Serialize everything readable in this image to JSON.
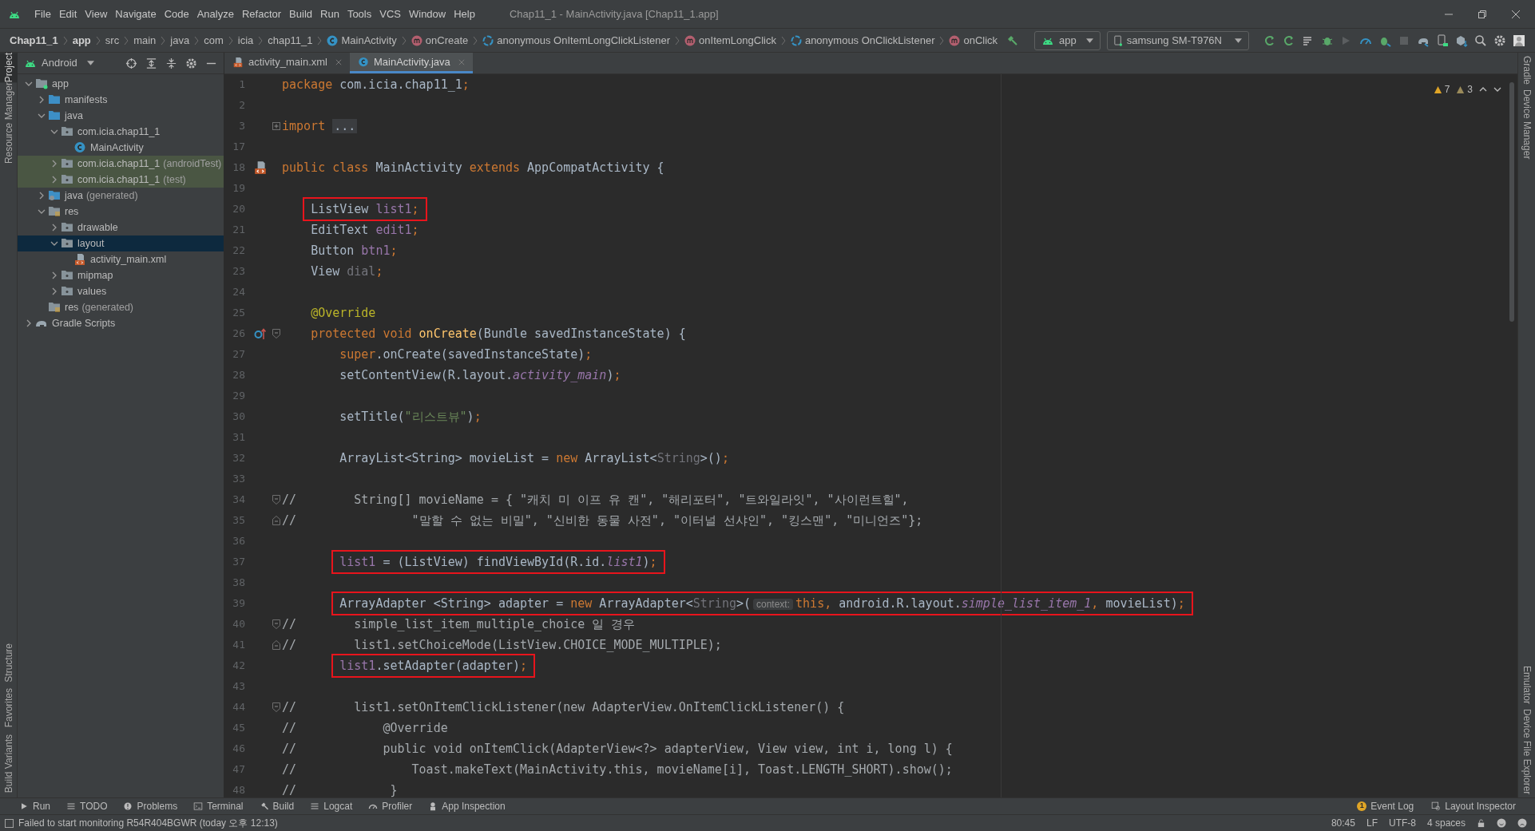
{
  "window": {
    "title": "Chap11_1 - MainActivity.java [Chap11_1.app]"
  },
  "menu": [
    "File",
    "Edit",
    "View",
    "Navigate",
    "Code",
    "Analyze",
    "Refactor",
    "Build",
    "Run",
    "Tools",
    "VCS",
    "Window",
    "Help"
  ],
  "breadcrumbs": [
    {
      "text": "Chap11_1",
      "kind": "project"
    },
    {
      "text": "app",
      "kind": "project"
    },
    {
      "text": "src",
      "kind": "folder"
    },
    {
      "text": "main",
      "kind": "folder"
    },
    {
      "text": "java",
      "kind": "folder"
    },
    {
      "text": "com",
      "kind": "folder"
    },
    {
      "text": "icia",
      "kind": "folder"
    },
    {
      "text": "chap11_1",
      "kind": "folder"
    },
    {
      "text": "MainActivity",
      "kind": "class"
    },
    {
      "text": "onCreate",
      "kind": "method"
    },
    {
      "text": "anonymous OnItemLongClickListener",
      "kind": "anonymous"
    },
    {
      "text": "onItemLongClick",
      "kind": "method"
    },
    {
      "text": "anonymous OnClickListener",
      "kind": "anonymous"
    },
    {
      "text": "onClick",
      "kind": "method"
    }
  ],
  "toolbar": {
    "run_config": "app",
    "device": "samsung SM-T976N"
  },
  "left_tool_tabs": [
    {
      "label": "Project",
      "selected": true
    },
    {
      "label": "Resource Manager",
      "selected": false
    }
  ],
  "left_tool_tabs_bottom": [
    "Structure",
    "Favorites",
    "Build Variants"
  ],
  "right_tool_tabs": [
    "Gradle",
    "Device Manager",
    "Emulator",
    "Device File Explorer"
  ],
  "project_panel": {
    "view": "Android",
    "tree": [
      {
        "label": "app",
        "kind": "module",
        "expanded": true,
        "selected": false,
        "tinted": false,
        "children": [
          {
            "label": "manifests",
            "kind": "source",
            "expanded": false,
            "selected": false,
            "tinted": false
          },
          {
            "label": "java",
            "kind": "source",
            "expanded": true,
            "selected": false,
            "tinted": false,
            "children": [
              {
                "label": "com.icia.chap11_1",
                "kind": "package",
                "expanded": true,
                "selected": false,
                "tinted": false,
                "children": [
                  {
                    "label": "MainActivity",
                    "kind": "class",
                    "selected": false,
                    "tinted": false
                  }
                ]
              },
              {
                "label": "com.icia.chap11_1",
                "suffix": "(androidTest)",
                "kind": "package",
                "expanded": false,
                "selected": false,
                "tinted": true
              },
              {
                "label": "com.icia.chap11_1",
                "suffix": "(test)",
                "kind": "package",
                "expanded": false,
                "selected": false,
                "tinted": true
              }
            ]
          },
          {
            "label": "java",
            "suffix": "(generated)",
            "kind": "generated",
            "expanded": false,
            "selected": false,
            "tinted": false
          },
          {
            "label": "res",
            "kind": "res",
            "expanded": true,
            "selected": false,
            "tinted": false,
            "children": [
              {
                "label": "drawable",
                "kind": "package",
                "expanded": false,
                "selected": false,
                "tinted": false
              },
              {
                "label": "layout",
                "kind": "package",
                "expanded": true,
                "selected": true,
                "tinted": false,
                "children": [
                  {
                    "label": "activity_main.xml",
                    "kind": "xml",
                    "selected": false,
                    "tinted": false
                  }
                ]
              },
              {
                "label": "mipmap",
                "kind": "package",
                "expanded": false,
                "selected": false,
                "tinted": false
              },
              {
                "label": "values",
                "kind": "package",
                "expanded": false,
                "selected": false,
                "tinted": false
              }
            ]
          },
          {
            "label": "res",
            "suffix": "(generated)",
            "kind": "res",
            "selected": false,
            "tinted": false
          }
        ]
      },
      {
        "label": "Gradle Scripts",
        "kind": "gradle",
        "expanded": false,
        "selected": false,
        "tinted": false
      }
    ]
  },
  "editor_tabs": [
    {
      "label": "activity_main.xml",
      "kind": "xml",
      "selected": false
    },
    {
      "label": "MainActivity.java",
      "kind": "class",
      "selected": true
    }
  ],
  "inspections": [
    {
      "kind": "warning",
      "count": "7"
    },
    {
      "kind": "weak_warning",
      "count": "3"
    }
  ],
  "lines": [
    {
      "number": "1",
      "highlighted": false,
      "tokens": [
        {
          "text": "package",
          "kind": "keyword"
        },
        {
          "text": " com.icia.chap11_1",
          "kind": "plain"
        },
        {
          "text": ";",
          "kind": "punct"
        }
      ]
    },
    {
      "number": "2"
    },
    {
      "number": "3",
      "highlighted": false,
      "fold_mark": {
        "kind": "collapsed"
      },
      "tokens": [
        {
          "text": "import ",
          "kind": "keyword"
        },
        {
          "text": "...",
          "kind": "folded"
        }
      ]
    },
    {
      "number": "17"
    },
    {
      "number": "18",
      "highlighted": false,
      "gutter_icon": {
        "kind": "layout"
      },
      "tokens": [
        {
          "text": "public class ",
          "kind": "keyword"
        },
        {
          "text": "MainActivity ",
          "kind": "plain"
        },
        {
          "text": "extends ",
          "kind": "keyword"
        },
        {
          "text": "AppCompatActivity {",
          "kind": "plain"
        }
      ]
    },
    {
      "number": "19"
    },
    {
      "number": "20",
      "highlighted": true,
      "tokens": [
        {
          "text": "    ListView ",
          "kind": "plain"
        },
        {
          "text": "list1",
          "kind": "field"
        },
        {
          "text": ";",
          "kind": "punct"
        }
      ]
    },
    {
      "number": "21",
      "highlighted": false,
      "tokens": [
        {
          "text": "    EditText ",
          "kind": "plain"
        },
        {
          "text": "edit1",
          "kind": "field"
        },
        {
          "text": ";",
          "kind": "punct"
        }
      ]
    },
    {
      "number": "22",
      "highlighted": false,
      "tokens": [
        {
          "text": "    Button ",
          "kind": "plain"
        },
        {
          "text": "btn1",
          "kind": "field"
        },
        {
          "text": ";",
          "kind": "punct"
        }
      ]
    },
    {
      "number": "23",
      "highlighted": false,
      "tokens": [
        {
          "text": "    View ",
          "kind": "plain"
        },
        {
          "text": "dial",
          "kind": "unused"
        },
        {
          "text": ";",
          "kind": "punct"
        }
      ]
    },
    {
      "number": "24"
    },
    {
      "number": "25",
      "highlighted": false,
      "tokens": [
        {
          "text": "    @Override",
          "kind": "annotation"
        }
      ]
    },
    {
      "number": "26",
      "highlighted": false,
      "gutter_icon": {
        "kind": "override"
      },
      "fold_mark": {
        "kind": "start"
      },
      "tokens": [
        {
          "text": "    protected void ",
          "kind": "keyword"
        },
        {
          "text": "onCreate",
          "kind": "method"
        },
        {
          "text": "(Bundle savedInstanceState) {",
          "kind": "plain"
        }
      ]
    },
    {
      "number": "27",
      "highlighted": false,
      "tokens": [
        {
          "text": "        super",
          "kind": "keyword"
        },
        {
          "text": ".onCreate(savedInstanceState)",
          "kind": "plain"
        },
        {
          "text": ";",
          "kind": "punct"
        }
      ]
    },
    {
      "number": "28",
      "highlighted": false,
      "tokens": [
        {
          "text": "        setContentView(R.layout.",
          "kind": "plain"
        },
        {
          "text": "activity_main",
          "kind": "static"
        },
        {
          "text": ")",
          "kind": "plain"
        },
        {
          "text": ";",
          "kind": "punct"
        }
      ]
    },
    {
      "number": "29"
    },
    {
      "number": "30",
      "highlighted": false,
      "tokens": [
        {
          "text": "        setTitle(",
          "kind": "plain"
        },
        {
          "text": "\"리스트뷰\"",
          "kind": "string"
        },
        {
          "text": ")",
          "kind": "plain"
        },
        {
          "text": ";",
          "kind": "punct"
        }
      ]
    },
    {
      "number": "31"
    },
    {
      "number": "32",
      "highlighted": false,
      "tokens": [
        {
          "text": "        ArrayList<String> movieList = ",
          "kind": "plain"
        },
        {
          "text": "new ",
          "kind": "keyword"
        },
        {
          "text": "ArrayList<",
          "kind": "plain"
        },
        {
          "text": "String",
          "kind": "unused"
        },
        {
          "text": ">()",
          "kind": "plain"
        },
        {
          "text": ";",
          "kind": "punct"
        }
      ]
    },
    {
      "number": "33"
    },
    {
      "number": "34",
      "highlighted": false,
      "fold_mark": {
        "kind": "start"
      },
      "tokens": [
        {
          "text": "//        String[] movieName = { \"캐치 미 이프 유 캔\", \"해리포터\", \"트와일라잇\", \"사이런트힐\",",
          "kind": "comment"
        }
      ]
    },
    {
      "number": "35",
      "highlighted": false,
      "fold_mark": {
        "kind": "end"
      },
      "tokens": [
        {
          "text": "//                \"말할 수 없는 비밀\", \"신비한 동물 사전\", \"이터널 선샤인\", \"킹스맨\", \"미니언즈\"};",
          "kind": "comment"
        }
      ]
    },
    {
      "number": "36"
    },
    {
      "number": "37",
      "highlighted": true,
      "tokens": [
        {
          "text": "        list1",
          "kind": "field"
        },
        {
          "text": " = (ListView) findViewById(R.id.",
          "kind": "plain"
        },
        {
          "text": "list1",
          "kind": "static"
        },
        {
          "text": ")",
          "kind": "plain"
        },
        {
          "text": ";",
          "kind": "punct"
        }
      ]
    },
    {
      "number": "38"
    },
    {
      "number": "39",
      "highlighted": true,
      "tokens": [
        {
          "text": "        ArrayAdapter <String> adapter = ",
          "kind": "plain"
        },
        {
          "text": "new ",
          "kind": "keyword"
        },
        {
          "text": "ArrayAdapter<",
          "kind": "plain"
        },
        {
          "text": "String",
          "kind": "unused"
        },
        {
          "text": ">(",
          "kind": "plain"
        },
        {
          "text": "context:",
          "kind": "hint"
        },
        {
          "text": "this, ",
          "kind": "keyword"
        },
        {
          "text": "android.R.layout.",
          "kind": "plain"
        },
        {
          "text": "simple_list_item_1",
          "kind": "static"
        },
        {
          "text": ", ",
          "kind": "punct"
        },
        {
          "text": "movieList)",
          "kind": "plain"
        },
        {
          "text": ";",
          "kind": "punct"
        }
      ]
    },
    {
      "number": "40",
      "highlighted": false,
      "fold_mark": {
        "kind": "start"
      },
      "tokens": [
        {
          "text": "//        simple_list_item_multiple_choice 일 경우",
          "kind": "comment"
        }
      ]
    },
    {
      "number": "41",
      "highlighted": false,
      "fold_mark": {
        "kind": "end"
      },
      "tokens": [
        {
          "text": "//        list1.setChoiceMode(ListView.CHOICE_MODE_MULTIPLE);",
          "kind": "comment"
        }
      ]
    },
    {
      "number": "42",
      "highlighted": true,
      "tokens": [
        {
          "text": "        list1",
          "kind": "field"
        },
        {
          "text": ".setAdapter(adapter)",
          "kind": "plain"
        },
        {
          "text": ";",
          "kind": "punct"
        }
      ]
    },
    {
      "number": "43"
    },
    {
      "number": "44",
      "highlighted": false,
      "fold_mark": {
        "kind": "start"
      },
      "tokens": [
        {
          "text": "//        list1.setOnItemClickListener(new AdapterView.OnItemClickListener() {",
          "kind": "comment"
        }
      ]
    },
    {
      "number": "45",
      "highlighted": false,
      "tokens": [
        {
          "text": "//            @Override",
          "kind": "comment"
        }
      ]
    },
    {
      "number": "46",
      "highlighted": false,
      "tokens": [
        {
          "text": "//            public void onItemClick(AdapterView<?> adapterView, View view, int i, long l) {",
          "kind": "comment"
        }
      ]
    },
    {
      "number": "47",
      "highlighted": false,
      "tokens": [
        {
          "text": "//                Toast.makeText(MainActivity.this, movieName[i], Toast.LENGTH_SHORT).show();",
          "kind": "comment"
        }
      ]
    },
    {
      "number": "48",
      "highlighted": false,
      "tokens": [
        {
          "text": "//             }",
          "kind": "comment"
        }
      ]
    }
  ],
  "tool_windows": [
    {
      "label": "Run",
      "kind": "run"
    },
    {
      "label": "TODO",
      "kind": "list"
    },
    {
      "label": "Problems",
      "kind": "problems"
    },
    {
      "label": "Terminal",
      "kind": "terminal"
    },
    {
      "label": "Build",
      "kind": "build"
    },
    {
      "label": "Logcat",
      "kind": "list"
    },
    {
      "label": "Profiler",
      "kind": "gauge"
    },
    {
      "label": "App Inspection",
      "kind": "inspect"
    }
  ],
  "tool_windows_right": [
    {
      "label": "Event Log",
      "badge": "1"
    },
    {
      "label": "Layout Inspector"
    }
  ],
  "status_bar": {
    "message": "Failed to start monitoring R54R404BGWR (today 오후 12:13)",
    "items": [
      "80:45",
      "LF",
      "UTF-8",
      "4 spaces"
    ]
  }
}
